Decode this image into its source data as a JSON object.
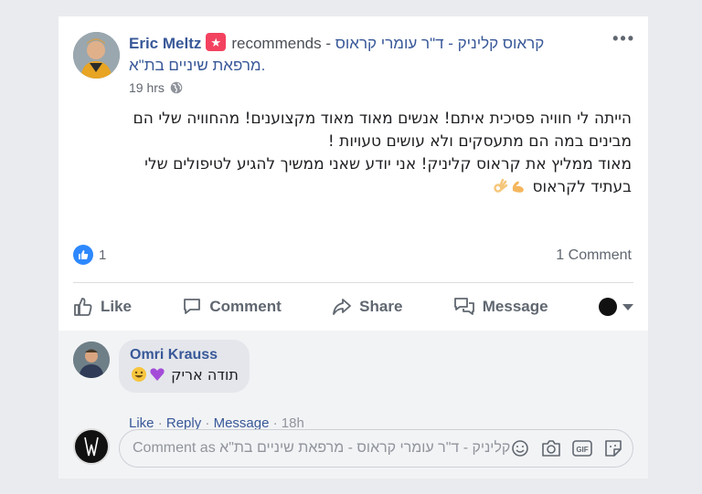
{
  "post": {
    "author": "Eric Meltz",
    "recommends_text": "recommends -",
    "page_name_line1": "קראוס קליניק - ד\"ר עומרי קראוס",
    "page_name_line2": "מרפאת שיניים בת\"א.",
    "time": "19 hrs",
    "more_label": "•••",
    "text_lines": [
      "הייתה לי חוויה פסיכית איתם! אנשים מאוד מאוד מקצוענים! מהחוויה שלי הם",
      "מבינים במה הם מתעסקים ולא עושים טעויות !",
      "מאוד ממליץ את קראוס קליניק! אני יודע שאני ממשיך להגיע לטיפולים שלי",
      "בעתיד לקראוס"
    ],
    "emojis": [
      "flexed-biceps",
      "ok-hand"
    ],
    "like_count": "1",
    "comment_count": "1 Comment"
  },
  "actions": {
    "like": "Like",
    "comment": "Comment",
    "share": "Share",
    "message": "Message"
  },
  "comment": {
    "author": "Omri Krauss",
    "text": "תודה אריק",
    "emojis": [
      "purple-heart",
      "grinning-face"
    ],
    "like": "Like",
    "reply": "Reply",
    "message": "Message",
    "separator": "·",
    "time": "18h"
  },
  "composer": {
    "placeholder": "Comment as קראוס קליניק - ד\"ר עומרי קראוס - מרפאת שיניים בת\"א",
    "icons": [
      "emoji-icon",
      "camera-icon",
      "gif-icon",
      "sticker-icon"
    ]
  },
  "colors": {
    "link": "#385898",
    "like_blue": "#2d88ff",
    "recommend_badge": "#f3425f",
    "muted": "#606770"
  }
}
